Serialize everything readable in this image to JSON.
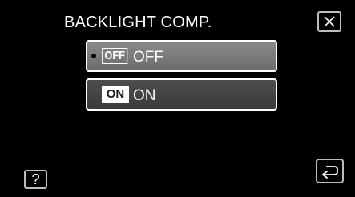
{
  "screen": {
    "title": "BACKLIGHT COMP."
  },
  "options": [
    {
      "icon_text": "OFF",
      "label": "OFF",
      "selected": true
    },
    {
      "icon_text": "ON",
      "label": "ON",
      "selected": false
    }
  ],
  "help": {
    "label": "?"
  },
  "icons": {
    "close": "close-icon",
    "back": "back-arrow-icon",
    "selected_marker": "selected-dot-icon"
  },
  "colors": {
    "background": "#000000",
    "button_border": "#ffffff",
    "selected_fill": "#7a7a7a",
    "unselected_fill": "#444444"
  }
}
